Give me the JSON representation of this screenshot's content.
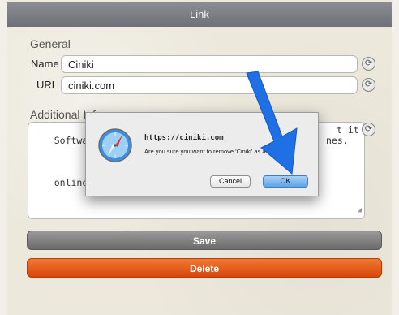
{
  "window": {
    "title": "Link"
  },
  "form": {
    "general_label": "General",
    "name_label": "Name",
    "name_value": "Ciniki",
    "url_label": "URL",
    "url_value": "ciniki.com",
    "additional_label": "Additional Information",
    "additional_visible_prefix": "Additional Inf",
    "description_line1_left": "Software to h",
    "description_line1_right": "t it",
    "description_line2_left": "online. Easy",
    "description_line2_right": "nes."
  },
  "buttons": {
    "save": "Save",
    "delete": "Delete"
  },
  "dialog": {
    "title": "https://ciniki.com",
    "message": "Are you sure you want to remove 'Ciniki' as a link ?",
    "cancel": "Cancel",
    "ok": "OK"
  },
  "colors": {
    "titlebar": "#7d7d84",
    "delete": "#e4561a",
    "save": "#838383",
    "ok_button": "#6aaeec",
    "annotation_arrow": "#1f6fe5"
  },
  "icons": {
    "reset": "refresh-icon",
    "dialog": "safari-compass-icon",
    "annotation": "blue-arrow-icon"
  }
}
